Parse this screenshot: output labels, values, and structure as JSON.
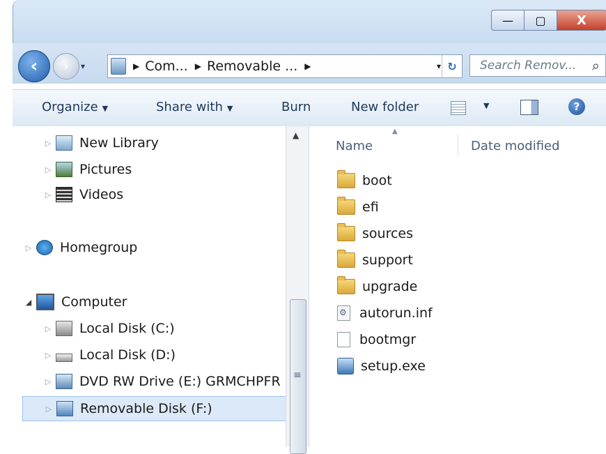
{
  "window": {
    "minimize_label": "—",
    "maximize_label": "▢",
    "close_label": "X"
  },
  "navigation": {
    "back_label": "‹",
    "forward_label": "›",
    "history_label": "▾",
    "address": [
      "Com...",
      "Removable ..."
    ],
    "dropdown_label": "▾",
    "refresh_label": "↻",
    "search_placeholder": "Search Remov...",
    "search_icon": "⌕"
  },
  "toolbar": {
    "organize": "Organize",
    "share_with": "Share with",
    "burn": "Burn",
    "new_folder": "New folder",
    "help": "?"
  },
  "nav_pane": [
    {
      "label": "New Library"
    },
    {
      "label": "Pictures"
    },
    {
      "label": "Videos"
    },
    {
      "label": "Homegroup"
    },
    {
      "label": "Computer"
    },
    {
      "label": "Local Disk (C:)"
    },
    {
      "label": "Local Disk (D:)"
    },
    {
      "label": "DVD RW Drive (E:) GRMCHPFR"
    },
    {
      "label": "Removable Disk (F:)"
    }
  ],
  "columns": {
    "name": "Name",
    "date_modified": "Date modified"
  },
  "files": [
    {
      "name": "boot",
      "type": "folder"
    },
    {
      "name": "efi",
      "type": "folder"
    },
    {
      "name": "sources",
      "type": "folder"
    },
    {
      "name": "support",
      "type": "folder"
    },
    {
      "name": "upgrade",
      "type": "folder"
    },
    {
      "name": "autorun.inf",
      "type": "config"
    },
    {
      "name": "bootmgr",
      "type": "file"
    },
    {
      "name": "setup.exe",
      "type": "exe"
    }
  ]
}
